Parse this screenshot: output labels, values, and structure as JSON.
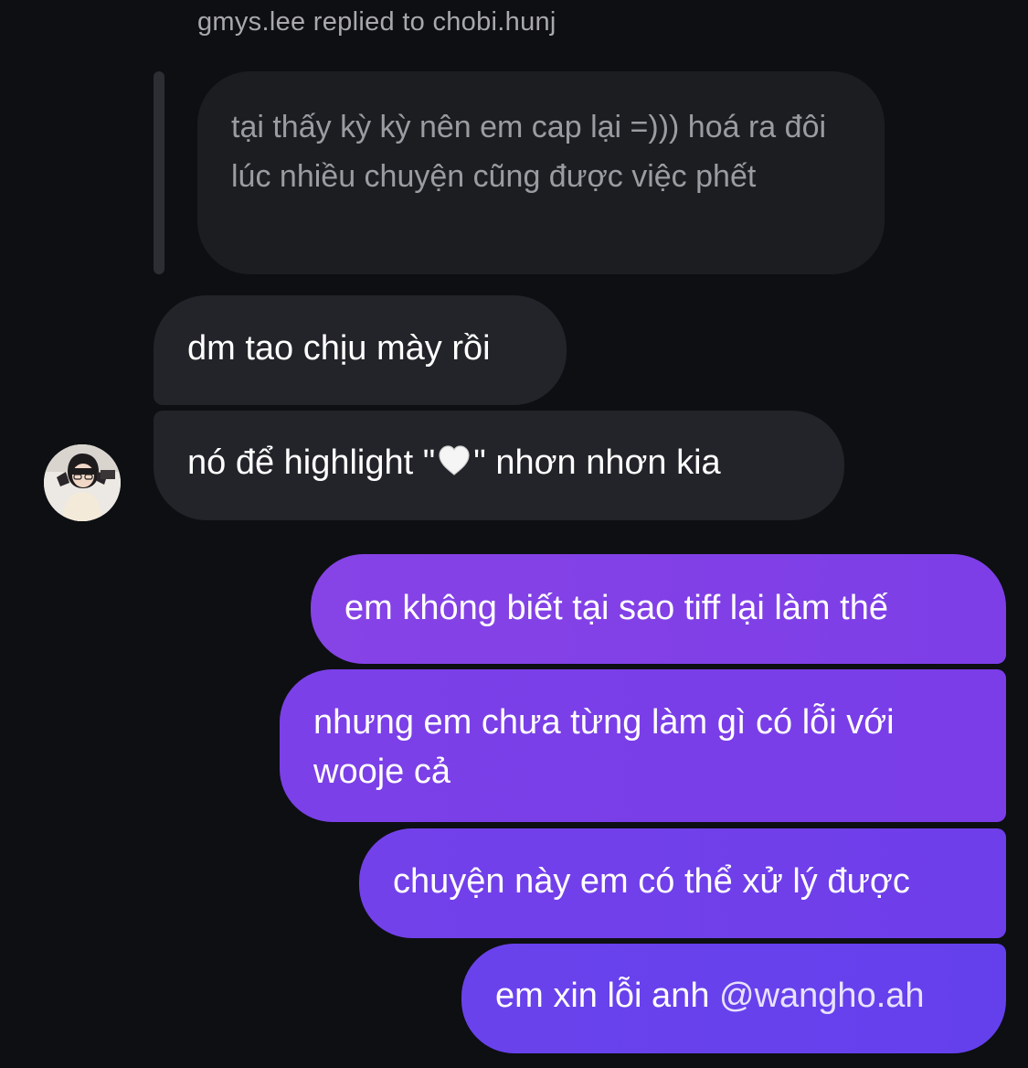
{
  "reply_header": "gmys.lee replied to chobi.hunj",
  "quoted_message": "tại thấy kỳ kỳ nên em cap lại =))) hoá ra đôi lúc nhiều chuyện cũng được việc phết",
  "incoming": [
    {
      "text": "dm tao chịu mày rồi"
    },
    {
      "text_before": "nó để highlight \"",
      "emoji": "white-heart",
      "text_after": "\" nhơn nhơn kia"
    }
  ],
  "outgoing": [
    {
      "text": "em không biết tại sao tiff lại làm thế"
    },
    {
      "text": "nhưng em chưa từng làm gì có lỗi với wooje cả"
    },
    {
      "text": "chuyện này em có thể xử lý được"
    },
    {
      "text": "em xin lỗi anh ",
      "mention": "@wangho.ah"
    }
  ],
  "colors": {
    "background": "#0d0f12",
    "incoming_bubble": "#222429",
    "quoted_bubble": "#1b1d21",
    "outgoing_bubble_top": "#8643e6",
    "outgoing_bubble_bottom": "#6440ec"
  }
}
